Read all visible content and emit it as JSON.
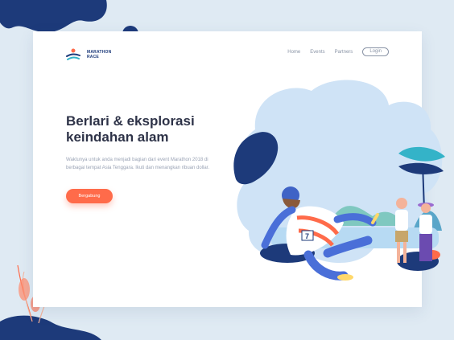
{
  "logo": {
    "line1": "MARATHON",
    "line2": "RACE"
  },
  "nav": {
    "home": "Home",
    "events": "Events",
    "partners": "Partners",
    "login": "Login"
  },
  "hero": {
    "title_line1": "Berlari & eksplorasi",
    "title_line2": "keindahan alam",
    "description": "Waktunya untuk anda menjadi bagian dari event Marathon 2018 di berbagai tempat Asia Tenggara. Ikuti dan menangkan ribuan dollar.",
    "cta_label": "Bergabung"
  },
  "runner_bib": "7",
  "colors": {
    "navy": "#1d3a7a",
    "accent": "#ff6b4a",
    "sky": "#cfe3f6",
    "teal": "#34b3c8",
    "background": "#dfeaf3"
  }
}
